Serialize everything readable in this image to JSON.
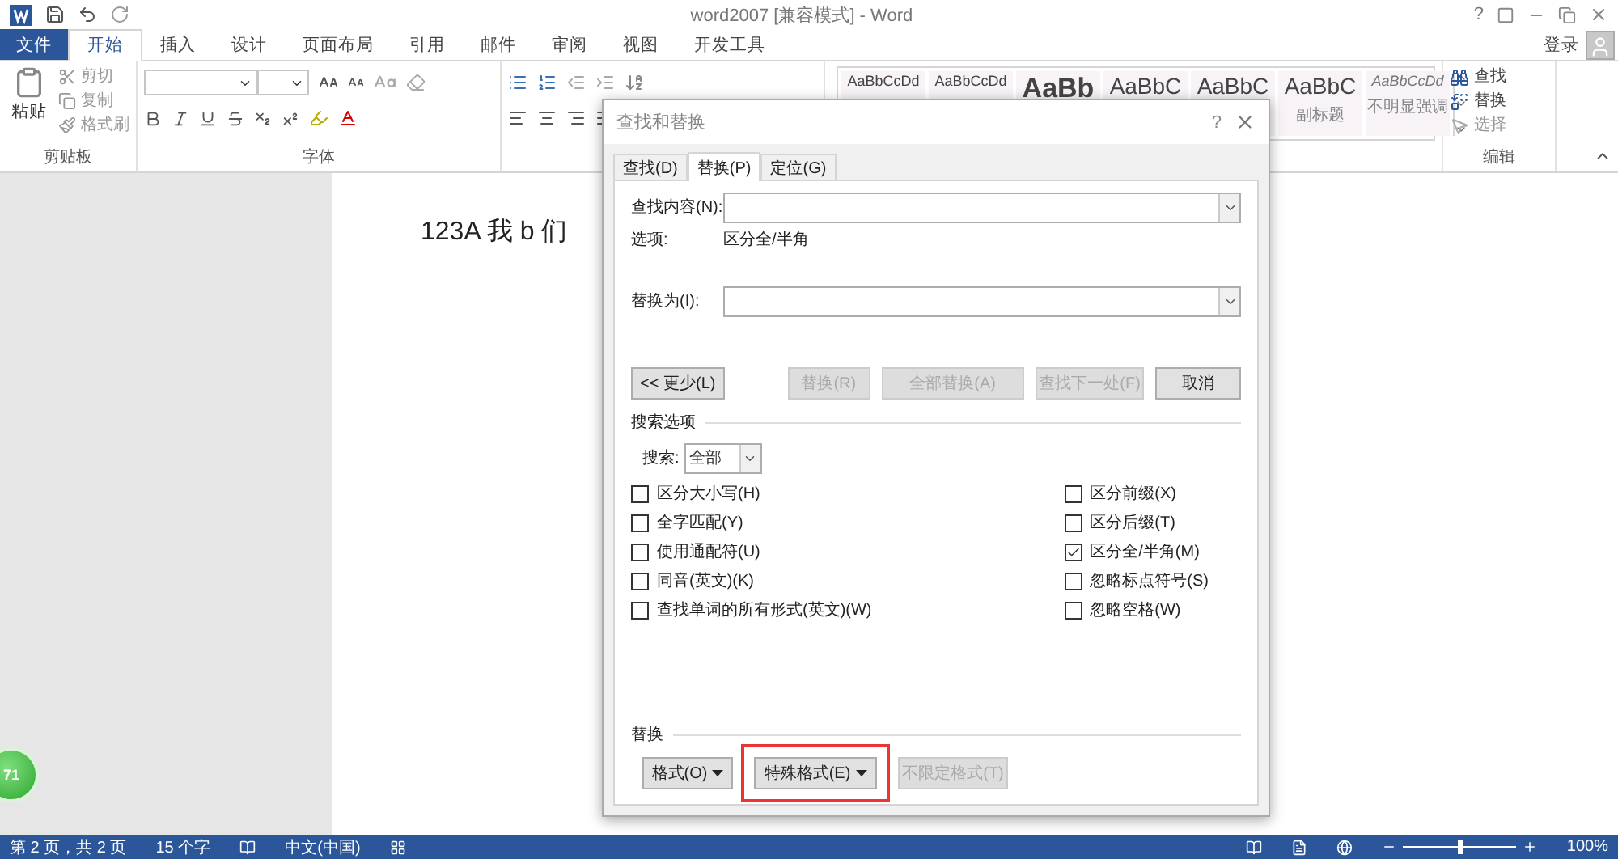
{
  "title_bar": {
    "title": "word2007 [兼容模式] - Word",
    "help": "?"
  },
  "file_menu": {
    "label": "文件"
  },
  "ribbon_tabs": [
    {
      "label": "开始",
      "selected": true
    },
    {
      "label": "插入",
      "selected": false
    },
    {
      "label": "设计",
      "selected": false
    },
    {
      "label": "页面布局",
      "selected": false
    },
    {
      "label": "引用",
      "selected": false
    },
    {
      "label": "邮件",
      "selected": false
    },
    {
      "label": "审阅",
      "selected": false
    },
    {
      "label": "视图",
      "selected": false
    },
    {
      "label": "开发工具",
      "selected": false
    }
  ],
  "account": {
    "label": "登录"
  },
  "clipboard": {
    "paste": "粘贴",
    "actions": [
      "剪切",
      "复制",
      "格式刷"
    ],
    "group_label": "剪贴板"
  },
  "font_group": {
    "label": "字体"
  },
  "styles": [
    {
      "sample": "AaBbCcDd",
      "kind": "normal"
    },
    {
      "sample": "AaBbCcDd",
      "kind": "normal"
    },
    {
      "sample": "AaBb",
      "kind": "title"
    },
    {
      "sample": "AaBbC",
      "kind": "heading"
    },
    {
      "sample": "AaBbC",
      "kind": "heading"
    },
    {
      "sample": "AaBbC",
      "kind": "heading",
      "label": "副标题"
    },
    {
      "sample": "AaBbCcDd",
      "kind": "emphasis",
      "label": "不明显强调"
    }
  ],
  "editing": {
    "group_label": "编辑",
    "items": [
      {
        "label": "查找",
        "kind": "find",
        "disabled": false
      },
      {
        "label": "替换",
        "kind": "replace",
        "disabled": false
      },
      {
        "label": "选择",
        "kind": "select",
        "disabled": true
      }
    ]
  },
  "document": {
    "text": "123A 我 b 们"
  },
  "badge": {
    "text": "71"
  },
  "dialog": {
    "title": "查找和替换",
    "help": "?",
    "tabs": [
      {
        "label": "查找(D)",
        "selected": false
      },
      {
        "label": "替换(P)",
        "selected": true
      },
      {
        "label": "定位(G)",
        "selected": false
      }
    ],
    "find": {
      "label": "查找内容(N):"
    },
    "options": {
      "label": "选项:",
      "value": "区分全/半角"
    },
    "replace": {
      "label": "替换为(I):"
    },
    "buttons": [
      {
        "label": "<< 更少(L)",
        "disabled": false
      },
      {
        "label": "替换(R)",
        "disabled": true
      },
      {
        "label": "全部替换(A)",
        "disabled": true
      },
      {
        "label": "查找下一处(F)",
        "disabled": true
      },
      {
        "label": "取消",
        "disabled": false
      }
    ],
    "search_options": {
      "heading": "搜索选项",
      "search_label": "搜索:",
      "search_value": "全部",
      "left": [
        {
          "label": "区分大小写(H)",
          "checked": false
        },
        {
          "label": "全字匹配(Y)",
          "checked": false
        },
        {
          "label": "使用通配符(U)",
          "checked": false
        },
        {
          "label": "同音(英文)(K)",
          "checked": false
        },
        {
          "label": "查找单词的所有形式(英文)(W)",
          "checked": false
        }
      ],
      "right": [
        {
          "label": "区分前缀(X)",
          "checked": false
        },
        {
          "label": "区分后缀(T)",
          "checked": false
        },
        {
          "label": "区分全/半角(M)",
          "checked": true
        },
        {
          "label": "忽略标点符号(S)",
          "checked": false
        },
        {
          "label": "忽略空格(W)",
          "checked": false
        }
      ]
    },
    "replace_section": {
      "heading": "替换",
      "buttons": [
        {
          "label": "格式(O)",
          "disabled": false,
          "dropdown": true,
          "highlighted": false
        },
        {
          "label": "特殊格式(E)",
          "disabled": false,
          "dropdown": true,
          "highlighted": true
        },
        {
          "label": "不限定格式(T)",
          "disabled": true,
          "dropdown": false,
          "highlighted": false
        }
      ]
    }
  },
  "status_bar": {
    "items": [
      "第 2 页，共 2 页",
      "15 个字",
      "中文(中国)"
    ],
    "zoom": {
      "level": 0.5,
      "label": "100%"
    }
  }
}
